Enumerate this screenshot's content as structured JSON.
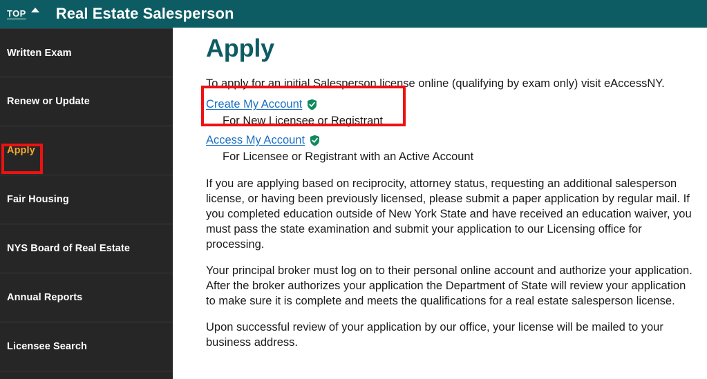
{
  "header": {
    "top_link_label": "TOP",
    "top_caret_icon": "caret-up-icon",
    "title": "Real Estate Salesperson",
    "background_color": "#0d5c63"
  },
  "sidebar": {
    "background_color": "#262626",
    "active_label_color": "#f0a830",
    "items": [
      {
        "label": "Written Exam",
        "active": false
      },
      {
        "label": "Renew or Update",
        "active": false
      },
      {
        "label": "Apply",
        "active": true
      },
      {
        "label": "Fair Housing",
        "active": false
      },
      {
        "label": "NYS Board of Real Estate",
        "active": false
      },
      {
        "label": "Annual Reports",
        "active": false
      },
      {
        "label": "Licensee Search",
        "active": false
      }
    ]
  },
  "main": {
    "title": "Apply",
    "title_color": "#0d5c63",
    "intro": "To apply for an initial Salesperson license online (qualifying by exam only) visit eAccessNY.",
    "account_links": [
      {
        "link_label": "Create My Account",
        "badge_icon": "green-shield-check-icon",
        "description": "For New Licensee or Registrant"
      },
      {
        "link_label": "Access My Account",
        "badge_icon": "green-shield-check-icon",
        "description": "For Licensee or Registrant with an Active Account"
      }
    ],
    "paragraphs": [
      "If you are applying based on reciprocity, attorney status, requesting an additional salesperson license, or having been previously licensed, please submit a paper application by regular mail. If you completed education outside of New York State and have received an education waiver, you must pass the state examination and submit your application to our Licensing office for processing.",
      "Your principal broker must log on to their personal online account and authorize your application. After the broker authorizes your application the Department of State will review your application to make sure it is complete and meets the qualifications for a real estate salesperson license.",
      "Upon successful review of your application by our office, your license will be mailed to your business address."
    ],
    "link_color": "#1a6fc4"
  },
  "annotations": {
    "color": "#ee1111",
    "boxes": [
      {
        "target": "sidebar-item-apply"
      },
      {
        "target": "create-my-account-block"
      }
    ]
  }
}
